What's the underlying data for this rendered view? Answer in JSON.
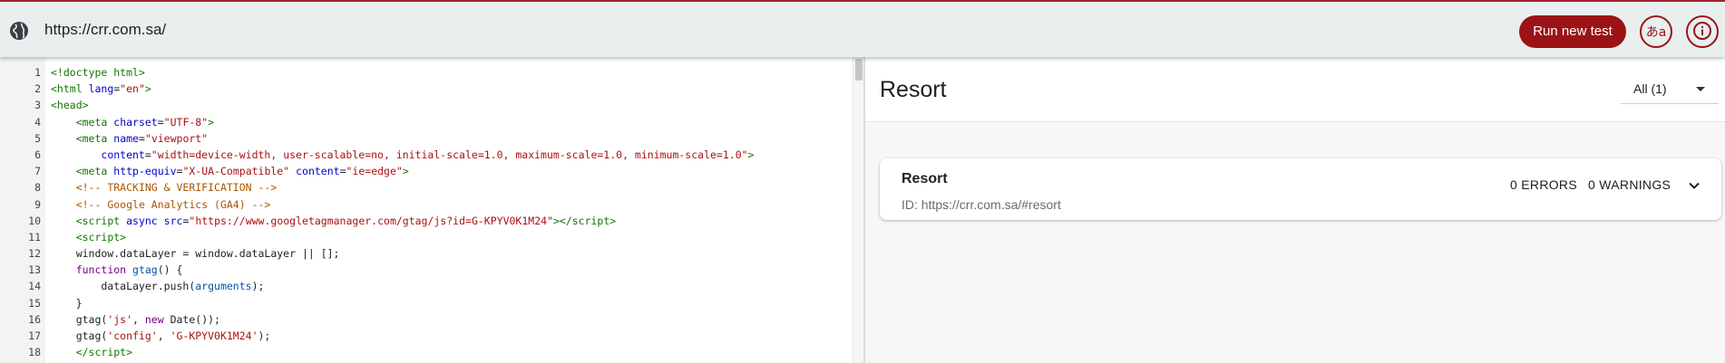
{
  "topbar": {
    "url": "https://crr.com.sa/",
    "run_label": "Run new test",
    "lang_label": "あa",
    "info_icon": "info-icon",
    "globe_icon": "globe-icon",
    "accent_color": "#9b1317"
  },
  "code": {
    "lines": [
      {
        "n": "1",
        "html": "<span class=\"tag\">&lt;!doctype html&gt;</span>"
      },
      {
        "n": "2",
        "html": "<span class=\"tag\">&lt;html</span> <span class=\"attr\">lang</span>=<span class=\"str\">\"en\"</span><span class=\"tag\">&gt;</span>"
      },
      {
        "n": "3",
        "html": "<span class=\"tag\">&lt;head&gt;</span>"
      },
      {
        "n": "4",
        "html": "    <span class=\"tag\">&lt;meta</span> <span class=\"attr\">charset</span>=<span class=\"str\">\"UTF-8\"</span><span class=\"tag\">&gt;</span>"
      },
      {
        "n": "5",
        "html": "    <span class=\"tag\">&lt;meta</span> <span class=\"attr\">name</span>=<span class=\"str\">\"viewport\"</span>"
      },
      {
        "n": "6",
        "html": "        <span class=\"attr\">content</span>=<span class=\"str\">\"width=device-width, user-scalable=no, initial-scale=1.0, maximum-scale=1.0, minimum-scale=1.0\"</span><span class=\"tag\">&gt;</span>"
      },
      {
        "n": "7",
        "html": "    <span class=\"tag\">&lt;meta</span> <span class=\"attr\">http-equiv</span>=<span class=\"str\">\"X-UA-Compatible\"</span> <span class=\"attr\">content</span>=<span class=\"str\">\"ie=edge\"</span><span class=\"tag\">&gt;</span>"
      },
      {
        "n": "8",
        "html": "    <span class=\"cmt\">&lt;!-- TRACKING &amp; VERIFICATION --&gt;</span>"
      },
      {
        "n": "9",
        "html": "    <span class=\"cmt\">&lt;!-- Google Analytics (GA4) --&gt;</span>"
      },
      {
        "n": "10",
        "html": "    <span class=\"tag\">&lt;script</span> <span class=\"attr\">async</span> <span class=\"attr\">src</span>=<span class=\"str\">\"https://www.googletagmanager.com/gtag/js?id=G-KPYV0K1M24\"</span><span class=\"tag\">&gt;&lt;/script&gt;</span>"
      },
      {
        "n": "11",
        "html": "    <span class=\"tag\">&lt;script&gt;</span>"
      },
      {
        "n": "12",
        "html": "    window.dataLayer = window.dataLayer || [];"
      },
      {
        "n": "13",
        "html": "    <span class=\"kw\">function</span> <span class=\"var\">gtag</span>() {"
      },
      {
        "n": "14",
        "html": "        dataLayer.push(<span class=\"var\">arguments</span>);"
      },
      {
        "n": "15",
        "html": "    }"
      },
      {
        "n": "16",
        "html": "    gtag(<span class=\"str\">'js'</span>, <span class=\"kw\">new</span> Date());"
      },
      {
        "n": "17",
        "html": "    gtag(<span class=\"str\">'config'</span>, <span class=\"str\">'G-KPYV0K1M24'</span>);"
      },
      {
        "n": "18",
        "html": "    <span class=\"tag\">&lt;/script&gt;</span>"
      }
    ]
  },
  "results": {
    "title": "Resort",
    "filter_label": "All (1)",
    "card": {
      "title": "Resort",
      "id_text": "ID: https://crr.com.sa/#resort",
      "errors": "0 ERRORS",
      "warnings": "0 WARNINGS"
    }
  }
}
